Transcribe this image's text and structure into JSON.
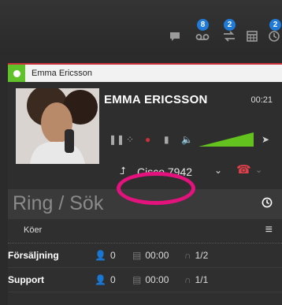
{
  "topbar": {
    "icons": [
      {
        "name": "chat-icon",
        "glyph": "💬"
      },
      {
        "name": "voicemail-icon",
        "glyph": "oo",
        "badge": "8"
      },
      {
        "name": "recordings-icon",
        "glyph": "⇆",
        "badge": "2"
      },
      {
        "name": "calculator-icon",
        "glyph": "▦"
      },
      {
        "name": "history-icon",
        "glyph": "⊙",
        "badge": "2"
      }
    ]
  },
  "call": {
    "contact_name": "Emma Ericsson",
    "caller_name": "EMMA ERICSSON",
    "duration": "00:21",
    "device": "Cisco 7942"
  },
  "dial": {
    "label": "Ring / Sök"
  },
  "queues": {
    "header": "Köer",
    "rows": [
      {
        "name": "Försäljning",
        "agents": "0",
        "wait": "00:00",
        "ratio": "1/2"
      },
      {
        "name": "Support",
        "agents": "0",
        "wait": "00:00",
        "ratio": "1/1"
      }
    ]
  },
  "colors": {
    "accent_red": "#c8303a",
    "status_green": "#5fc22a",
    "badge_blue": "#1f7ad8",
    "highlight_pink": "#e3127d"
  }
}
